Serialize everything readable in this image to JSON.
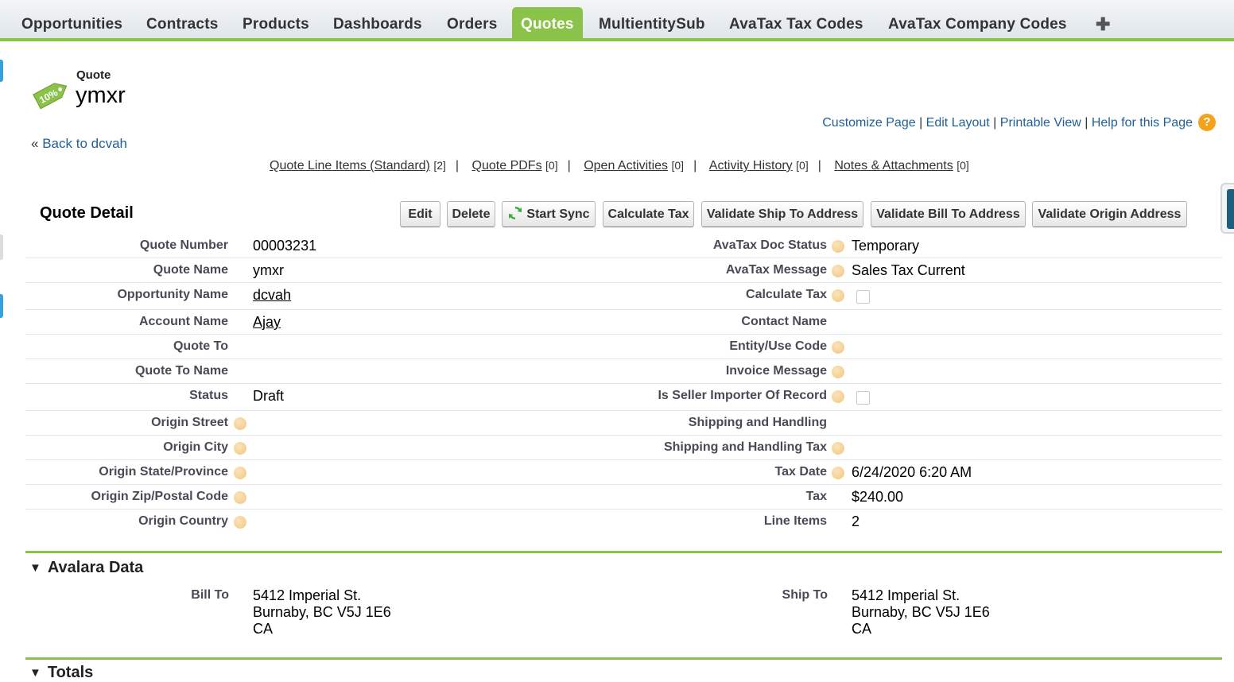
{
  "tabs": [
    {
      "label": "Opportunities",
      "active": false
    },
    {
      "label": "Contracts",
      "active": false
    },
    {
      "label": "Products",
      "active": false
    },
    {
      "label": "Dashboards",
      "active": false
    },
    {
      "label": "Orders",
      "active": false
    },
    {
      "label": "Quotes",
      "active": true
    },
    {
      "label": "MultientitySub",
      "active": false
    },
    {
      "label": "AvaTax Tax Codes",
      "active": false
    },
    {
      "label": "AvaTax Company Codes",
      "active": false
    },
    {
      "label": "✚",
      "active": false
    }
  ],
  "header": {
    "object_label": "Quote",
    "record_name": "ymxr",
    "icon_text": "10%",
    "top_links": [
      "Customize Page",
      "Edit Layout",
      "Printable View",
      "Help for this Page"
    ],
    "back_prefix": "«",
    "back_link": "Back to dcvah"
  },
  "related_links": [
    {
      "label": "Quote Line Items (Standard)",
      "count": "[2]"
    },
    {
      "label": "Quote PDFs",
      "count": "[0]"
    },
    {
      "label": "Open Activities",
      "count": "[0]"
    },
    {
      "label": "Activity History",
      "count": "[0]"
    },
    {
      "label": "Notes & Attachments",
      "count": "[0]"
    }
  ],
  "detail": {
    "title": "Quote Detail",
    "buttons": [
      "Edit",
      "Delete",
      "Start Sync",
      "Calculate Tax",
      "Validate Ship To Address",
      "Validate Bill To Address",
      "Validate Origin Address"
    ],
    "left_fields": [
      {
        "label": "Quote Number",
        "value": "00003231",
        "link": false,
        "help": false
      },
      {
        "label": "Quote Name",
        "value": "ymxr",
        "link": false,
        "help": false
      },
      {
        "label": "Opportunity Name",
        "value": "dcvah",
        "link": true,
        "help": false
      },
      {
        "label": "Account Name",
        "value": "Ajay",
        "link": true,
        "help": false
      },
      {
        "label": "Quote To",
        "value": "",
        "link": false,
        "help": false
      },
      {
        "label": "Quote To Name",
        "value": "",
        "link": false,
        "help": false
      },
      {
        "label": "Status",
        "value": "Draft",
        "link": false,
        "help": false
      },
      {
        "label": "Origin Street",
        "value": "",
        "link": false,
        "help": true
      },
      {
        "label": "Origin City",
        "value": "",
        "link": false,
        "help": true
      },
      {
        "label": "Origin State/Province",
        "value": "",
        "link": false,
        "help": true
      },
      {
        "label": "Origin Zip/Postal Code",
        "value": "",
        "link": false,
        "help": true
      },
      {
        "label": "Origin Country",
        "value": "",
        "link": false,
        "help": true
      }
    ],
    "right_fields": [
      {
        "label": "AvaTax Doc Status",
        "value": "Temporary",
        "help": true,
        "checkbox": false,
        "checked": false
      },
      {
        "label": "AvaTax Message",
        "value": "Sales Tax Current",
        "help": true,
        "checkbox": false,
        "checked": false
      },
      {
        "label": "Calculate Tax",
        "value": "",
        "help": true,
        "checkbox": true,
        "checked": false
      },
      {
        "label": "Contact Name",
        "value": "",
        "help": false,
        "checkbox": false,
        "checked": false
      },
      {
        "label": "Entity/Use Code",
        "value": "",
        "help": true,
        "checkbox": false,
        "checked": false
      },
      {
        "label": "Invoice Message",
        "value": "",
        "help": true,
        "checkbox": false,
        "checked": false
      },
      {
        "label": "Is Seller Importer Of Record",
        "value": "",
        "help": true,
        "checkbox": true,
        "checked": false
      },
      {
        "label": "Shipping and Handling",
        "value": "",
        "help": false,
        "checkbox": false,
        "checked": false
      },
      {
        "label": "Shipping and Handling Tax",
        "value": "",
        "help": true,
        "checkbox": false,
        "checked": false
      },
      {
        "label": "Tax Date",
        "value": "6/24/2020 6:20 AM",
        "help": true,
        "checkbox": false,
        "checked": false
      },
      {
        "label": "Tax",
        "value": "$240.00",
        "help": false,
        "checkbox": false,
        "checked": false
      },
      {
        "label": "Line Items",
        "value": "2",
        "help": false,
        "checkbox": false,
        "checked": false
      }
    ]
  },
  "avalara": {
    "title": "Avalara Data",
    "bill_to_label": "Bill To",
    "bill_to": [
      "5412 Imperial St.",
      "Burnaby, BC V5J 1E6",
      "CA"
    ],
    "ship_to_label": "Ship To",
    "ship_to": [
      "5412 Imperial St.",
      "Burnaby, BC V5J 1E6",
      "CA"
    ]
  },
  "totals": {
    "title": "Totals"
  },
  "colors": {
    "accent_green": "#8bc34a",
    "link_blue": "#1f5f9a",
    "help_orange": "#f4a21b"
  }
}
